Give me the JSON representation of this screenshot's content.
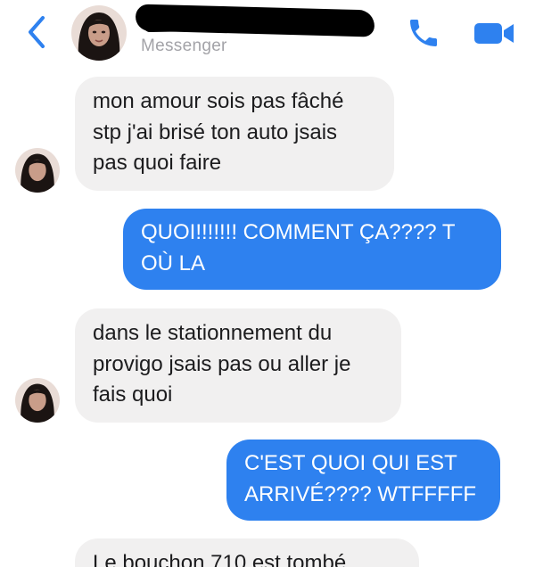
{
  "header": {
    "subtitle": "Messenger",
    "back_icon": "chevron-left-icon",
    "call_icon": "phone-icon",
    "video_icon": "video-camera-icon",
    "accent_color": "#2e81ef"
  },
  "messages": [
    {
      "direction": "incoming",
      "text": "mon amour sois pas fâché\nstp j'ai brisé ton auto jsais\npas quoi faire"
    },
    {
      "direction": "outgoing",
      "text": "QUOI!!!!!!! COMMENT ÇA???? T\nOÙ LA"
    },
    {
      "direction": "incoming",
      "text": "dans le stationnement du\nprovigo jsais pas ou aller je\nfais quoi"
    },
    {
      "direction": "outgoing",
      "text": "C'EST QUOI QUI EST\nARRIVÉ???? WTFFFFF"
    },
    {
      "direction": "incoming",
      "text": "Le bouchon 710 est tombé"
    }
  ]
}
